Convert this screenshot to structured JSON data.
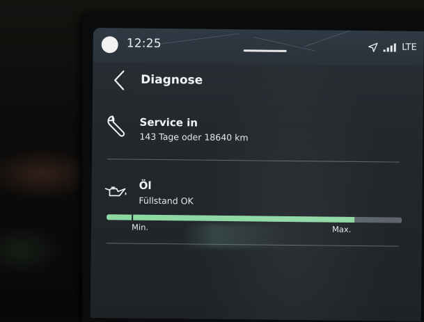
{
  "status_bar": {
    "time": "12:25",
    "network": "LTE",
    "icons": [
      "profile-avatar",
      "navigation-arrow-icon",
      "signal-bars-icon"
    ]
  },
  "header": {
    "title": "Diagnose",
    "back_icon": "chevron-left-icon"
  },
  "service": {
    "icon": "wrench-icon",
    "title": "Service in",
    "detail": "143 Tage oder 18640 km"
  },
  "oil": {
    "icon": "oil-can-icon",
    "title": "Öl",
    "status": "Füllstand OK",
    "level_fraction": 0.84,
    "min_label": "Min.",
    "max_label": "Max."
  },
  "colors": {
    "accent_green": "#8ed8a4",
    "screen_bg": "#23282d",
    "text": "#f3f4f5"
  }
}
